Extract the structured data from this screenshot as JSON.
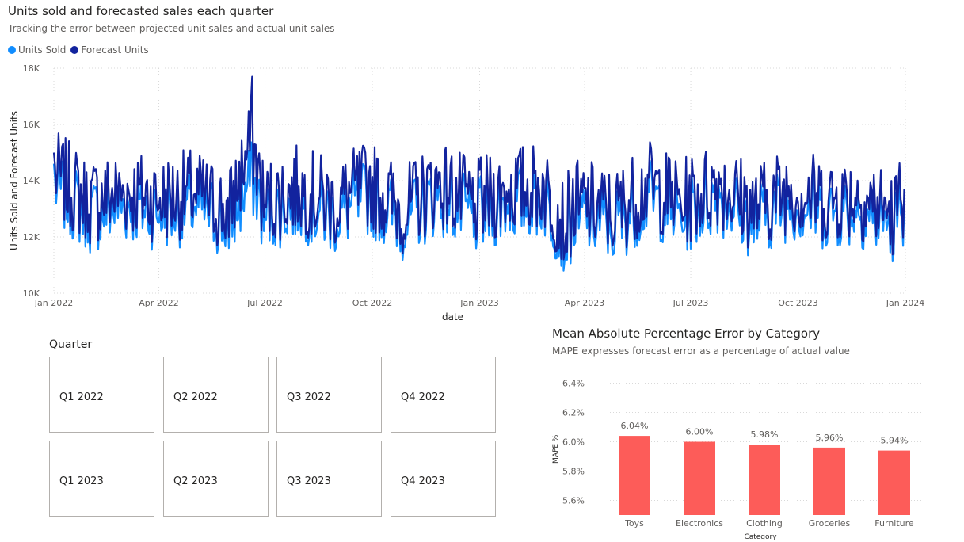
{
  "line_chart": {
    "title": "Units sold and forecasted sales each quarter",
    "subtitle": "Tracking the error between projected unit sales and actual unit sales",
    "legend": [
      {
        "name": "Units Sold",
        "color": "#118dff"
      },
      {
        "name": "Forecast Units",
        "color": "#12239e"
      }
    ]
  },
  "slicer": {
    "title": "Quarter",
    "items": [
      "Q1 2022",
      "Q2 2022",
      "Q3 2022",
      "Q4 2022",
      "Q1 2023",
      "Q2 2023",
      "Q3 2023",
      "Q4 2023"
    ]
  },
  "bar_chart": {
    "title": "Mean Absolute Percentage Error by Category",
    "subtitle": "MAPE expresses forecast error as a percentage of actual value"
  },
  "chart_data": [
    {
      "type": "line",
      "title": "Units sold and forecasted sales each quarter",
      "subtitle": "Tracking the error between projected unit sales and actual unit sales",
      "xlabel": "date",
      "ylabel": "Units Sold and Forecast Units",
      "x_range": [
        "2022-01-01",
        "2024-01-01"
      ],
      "x_ticks": [
        "Jan 2022",
        "Apr 2022",
        "Jul 2022",
        "Oct 2022",
        "Jan 2023",
        "Apr 2023",
        "Jul 2023",
        "Oct 2023",
        "Jan 2024"
      ],
      "ylim": [
        10000,
        18000
      ],
      "y_ticks": [
        "10K",
        "12K",
        "14K",
        "16K",
        "18K"
      ],
      "grid": true,
      "legend_position": "top-left",
      "series": [
        {
          "name": "Units Sold",
          "color": "#118dff",
          "x": [
            "2022-01-01",
            "2022-01-31",
            "2022-03-02",
            "2022-04-01",
            "2022-05-01",
            "2022-05-31",
            "2022-06-20",
            "2022-06-30",
            "2022-07-30",
            "2022-08-29",
            "2022-09-28",
            "2022-10-28",
            "2022-11-27",
            "2022-12-27",
            "2023-01-26",
            "2023-02-25",
            "2023-03-14",
            "2023-03-27",
            "2023-04-26",
            "2023-05-26",
            "2023-06-25",
            "2023-07-25",
            "2023-08-24",
            "2023-09-23",
            "2023-10-23",
            "2023-11-22",
            "2023-12-22",
            "2023-12-31"
          ],
          "values": [
            14600,
            12200,
            13100,
            12500,
            13000,
            11600,
            15200,
            12200,
            13300,
            12100,
            13700,
            11700,
            13800,
            12000,
            13200,
            13500,
            10800,
            12300,
            11400,
            13600,
            12200,
            13800,
            11800,
            13300,
            12500,
            12800,
            11400,
            13100
          ]
        },
        {
          "name": "Forecast Units",
          "color": "#12239e",
          "x": [
            "2022-01-01",
            "2022-01-31",
            "2022-03-02",
            "2022-04-01",
            "2022-05-01",
            "2022-05-31",
            "2022-06-20",
            "2022-06-30",
            "2022-07-30",
            "2022-08-29",
            "2022-09-28",
            "2022-10-28",
            "2022-11-27",
            "2022-12-27",
            "2023-01-26",
            "2023-02-25",
            "2023-03-14",
            "2023-03-27",
            "2023-04-26",
            "2023-05-26",
            "2023-06-25",
            "2023-07-25",
            "2023-08-24",
            "2023-09-23",
            "2023-10-23",
            "2023-11-22",
            "2023-12-22",
            "2023-12-31"
          ],
          "values": [
            15000,
            12800,
            13600,
            13000,
            13500,
            12000,
            17700,
            12700,
            13800,
            12600,
            14200,
            12100,
            14300,
            12500,
            13700,
            14000,
            11200,
            12800,
            11900,
            14100,
            12700,
            14300,
            12300,
            13800,
            13000,
            13300,
            11800,
            13700
          ]
        }
      ]
    },
    {
      "type": "bar",
      "title": "Mean Absolute Percentage Error by Category",
      "subtitle": "MAPE expresses forecast error as a percentage of actual value",
      "xlabel": "Category",
      "ylabel": "MAPE %",
      "categories": [
        "Toys",
        "Electronics",
        "Clothing",
        "Groceries",
        "Furniture"
      ],
      "values": [
        6.04,
        6.0,
        5.98,
        5.96,
        5.94
      ],
      "data_labels": [
        "6.04%",
        "6.00%",
        "5.98%",
        "5.96%",
        "5.94%"
      ],
      "ylim": [
        5.5,
        6.5
      ],
      "y_ticks": [
        "5.6%",
        "5.8%",
        "6.0%",
        "6.2%",
        "6.4%"
      ],
      "color": "#fd5c59",
      "grid": true
    }
  ]
}
